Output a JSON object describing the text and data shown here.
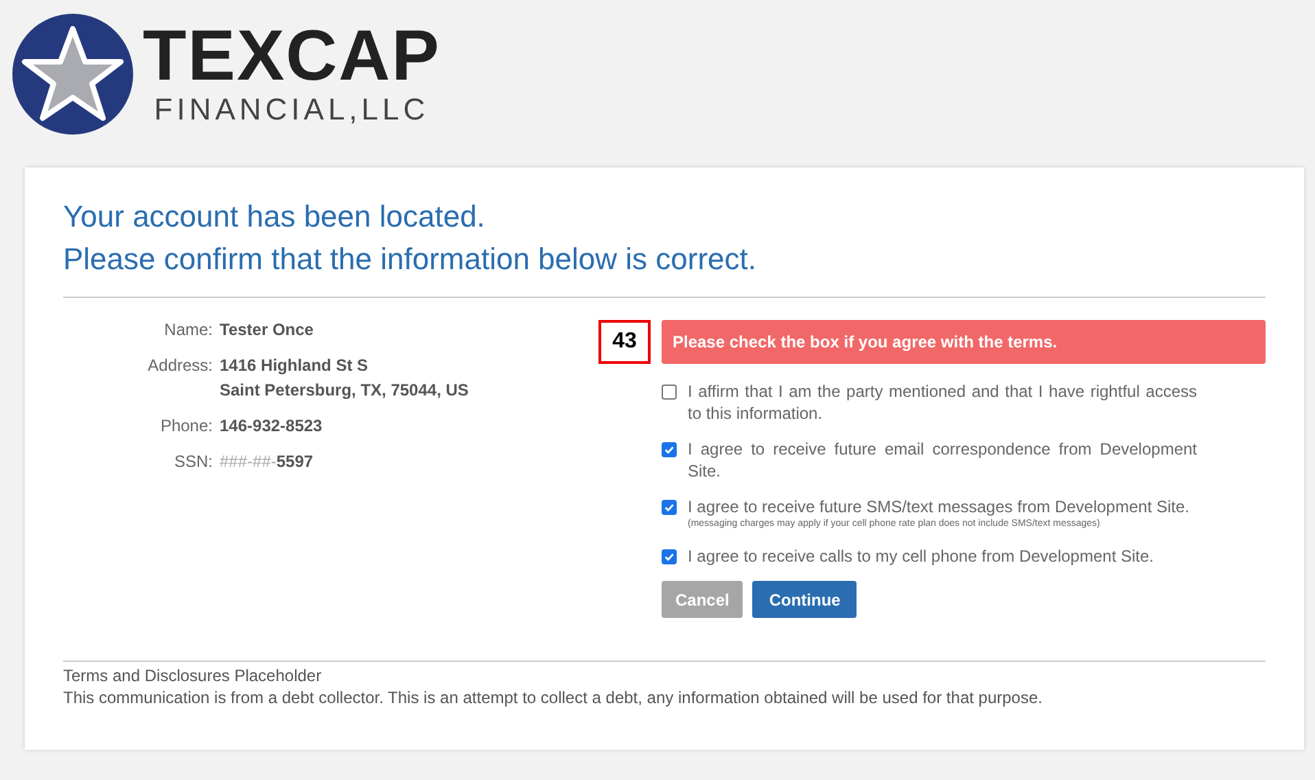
{
  "logo": {
    "name": "TEXCAP",
    "subtitle": "FINANCIAL,LLC"
  },
  "heading": [
    "Your account has been located.",
    "Please confirm that the information below is correct."
  ],
  "fields": [
    {
      "label": "Name:",
      "lines": [
        "Tester Once"
      ]
    },
    {
      "label": "Address:",
      "lines": [
        "1416 Highland St S",
        "Saint Petersburg, TX, 75044, US"
      ]
    },
    {
      "label": "Phone:",
      "lines": [
        "146-932-8523"
      ]
    },
    {
      "label": "SSN:",
      "masked": "###-##-",
      "lines": [
        "5597"
      ]
    }
  ],
  "marker": "43",
  "alert": "Please check the box if you agree with the terms.",
  "agreements": [
    {
      "text": "I affirm that I am the party mentioned and that I have rightful access to this information.",
      "checked": false
    },
    {
      "text": "I agree to receive future email correspondence from Development Site.",
      "checked": true
    },
    {
      "text": "I agree to receive future SMS/text messages from Development Site.",
      "note": "(messaging charges may apply if your cell phone rate plan does not include SMS/text messages)",
      "checked": true
    },
    {
      "text": "I agree to receive calls to my cell phone from Development Site.",
      "checked": true
    }
  ],
  "buttons": [
    {
      "label": "Cancel",
      "kind": "secondary"
    },
    {
      "label": "Continue",
      "kind": "primary"
    }
  ],
  "footer": {
    "title": "Terms and Disclosures Placeholder",
    "text": "This communication is from a debt collector. This is an attempt to collect a debt, any information obtained will be used for that purpose."
  }
}
